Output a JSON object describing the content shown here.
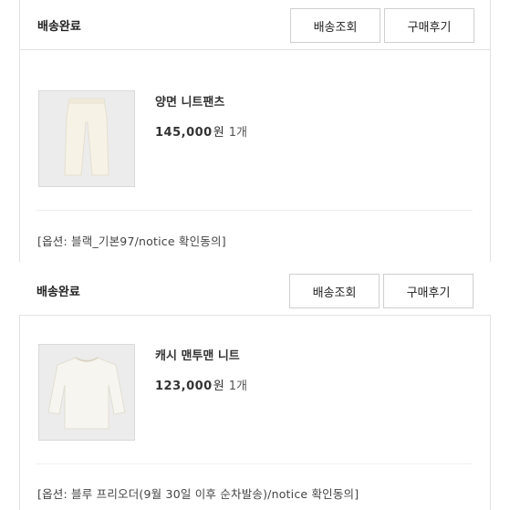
{
  "orders": [
    {
      "status": "배송완료",
      "track_label": "배송조회",
      "review_label": "구매후기",
      "product_name": "양면 니트팬츠",
      "price": "145,000",
      "currency": "원",
      "quantity": "1개",
      "option": "[옵션: 블랙_기본97/notice 확인동의]"
    },
    {
      "status": "배송완료",
      "track_label": "배송조회",
      "review_label": "구매후기",
      "product_name": "캐시 맨투맨 니트",
      "price": "123,000",
      "currency": "원",
      "quantity": "1개",
      "option": "[옵션: 블루 프리오더(9월 30일 이후 순차발송)/notice 확인동의]"
    }
  ]
}
